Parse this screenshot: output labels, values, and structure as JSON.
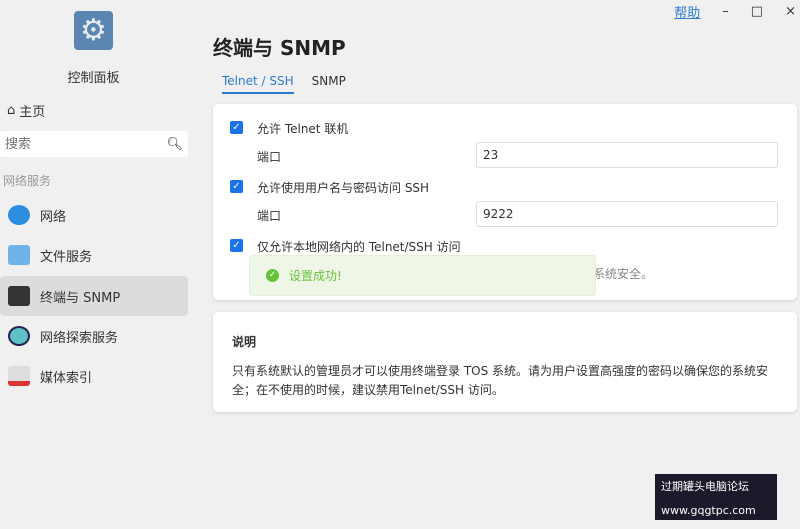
{
  "window": {
    "help": "帮助",
    "minimize": "–",
    "maximize": "□",
    "close": "×"
  },
  "sidebar": {
    "app_name": "控制面板",
    "home": "主页",
    "search_placeholder": "搜索",
    "section": "网络服务",
    "items": [
      {
        "label": "网络",
        "icon": "globe-icon"
      },
      {
        "label": "文件服务",
        "icon": "file-service-icon"
      },
      {
        "label": "终端与 SNMP",
        "icon": "terminal-icon",
        "active": true
      },
      {
        "label": "网络探索服务",
        "icon": "discovery-icon"
      },
      {
        "label": "媒体索引",
        "icon": "media-index-icon"
      }
    ]
  },
  "page": {
    "title": "终端与 SNMP",
    "tabs": [
      {
        "label": "Telnet / SSH",
        "active": true
      },
      {
        "label": "SNMP"
      }
    ]
  },
  "settings": {
    "telnet_label": "允许 Telnet 联机",
    "telnet_checked": true,
    "port_label": "端口",
    "telnet_port": "23",
    "ssh_label": "允许使用用户名与密码访问 SSH",
    "ssh_checked": true,
    "ssh_port": "9222",
    "local_label": "仅允许本地网络内的 Telnet/SSH 访问",
    "local_checked": true,
    "hint_fragment": "系统安全。"
  },
  "toast": {
    "text": "设置成功!"
  },
  "info": {
    "title": "说明",
    "text": "只有系统默认的管理员才可以使用终端登录 TOS 系统。请为用户设置高强度的密码以确保您的系统安全；在不使用的时候，建议禁用Telnet/SSH 访问。"
  },
  "watermark": {
    "line1": "过期罐头电脑论坛",
    "line2": "www.gqgtpc.com"
  },
  "colors": {
    "accent": "#1a73e8",
    "success": "#67c23a"
  }
}
